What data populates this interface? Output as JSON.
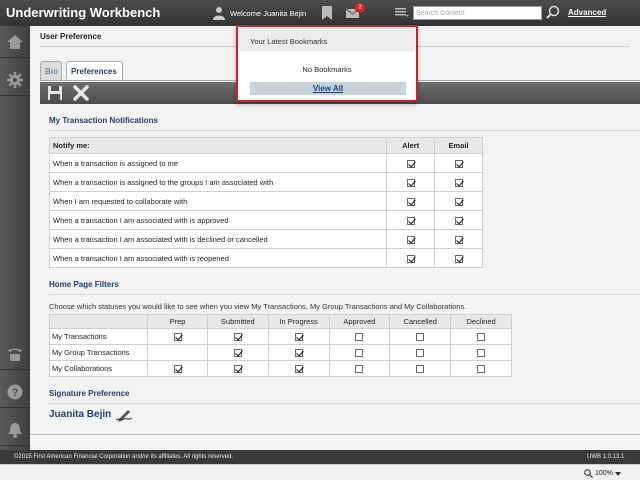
{
  "header": {
    "app_title": "Underwriting Workbench",
    "welcome": "Welcome Juanita Bejin",
    "mail_count": "2",
    "search_placeholder": "Search Content",
    "advanced_label": "Advanced"
  },
  "sidebar": {
    "items": [
      {
        "icon": "home-icon"
      },
      {
        "icon": "gear-icon"
      },
      {
        "icon": "phone-icon"
      },
      {
        "icon": "help-icon"
      },
      {
        "icon": "bell-icon"
      }
    ]
  },
  "page": {
    "title": "User Preference",
    "tabs": [
      {
        "label": "Bio",
        "active": false
      },
      {
        "label": "Preferences",
        "active": true
      }
    ]
  },
  "notifications": {
    "title": "My Transaction Notifications",
    "headers": [
      "Notify me:",
      "Alert",
      "Email"
    ],
    "rows": [
      {
        "label": "When a transaction is assigned to me",
        "alert": true,
        "email": true
      },
      {
        "label": "When a transaction is assigned to the groups I am associated with",
        "alert": true,
        "email": true
      },
      {
        "label": "When I am requested to collaborate with",
        "alert": true,
        "email": true
      },
      {
        "label": "When a transaction I am associated with is approved",
        "alert": true,
        "email": true
      },
      {
        "label": "When a transaction I am associated with is declined or cancelled",
        "alert": true,
        "email": true
      },
      {
        "label": "When a transaction I am associated with is reopened",
        "alert": true,
        "email": true
      }
    ]
  },
  "filters": {
    "title": "Home Page Filters",
    "description": "Choose which statuses you would like to see when you view My Transactions, My Group Transactions and My Collaborations.",
    "columns": [
      "",
      "Prep",
      "Submitted",
      "In Progress",
      "Approved",
      "Cancelled",
      "Declined"
    ],
    "rows": [
      {
        "label": "My Transactions",
        "values": [
          true,
          true,
          true,
          false,
          false,
          false
        ]
      },
      {
        "label": "My Group Transactions",
        "values": [
          false,
          true,
          true,
          false,
          false,
          false
        ]
      },
      {
        "label": "My Collaborations",
        "values": [
          true,
          true,
          true,
          false,
          false,
          false
        ]
      }
    ]
  },
  "signature": {
    "title": "Signature Preference",
    "name": "Juanita Bejin"
  },
  "bookmarks_popup": {
    "header": "Your Latest Bookmarks",
    "empty_text": "No Bookmarks",
    "view_all": "View All"
  },
  "footer": {
    "copyright": "©2015 First American Financial Corporation and/or its affiliates. All rights reserved.",
    "version": "UWB 1.0.13.1"
  },
  "statusbar": {
    "zoom": "100%"
  },
  "colors": {
    "accent": "#1f3f74",
    "highlight_border": "#d0202a",
    "badge": "#d9232d"
  }
}
